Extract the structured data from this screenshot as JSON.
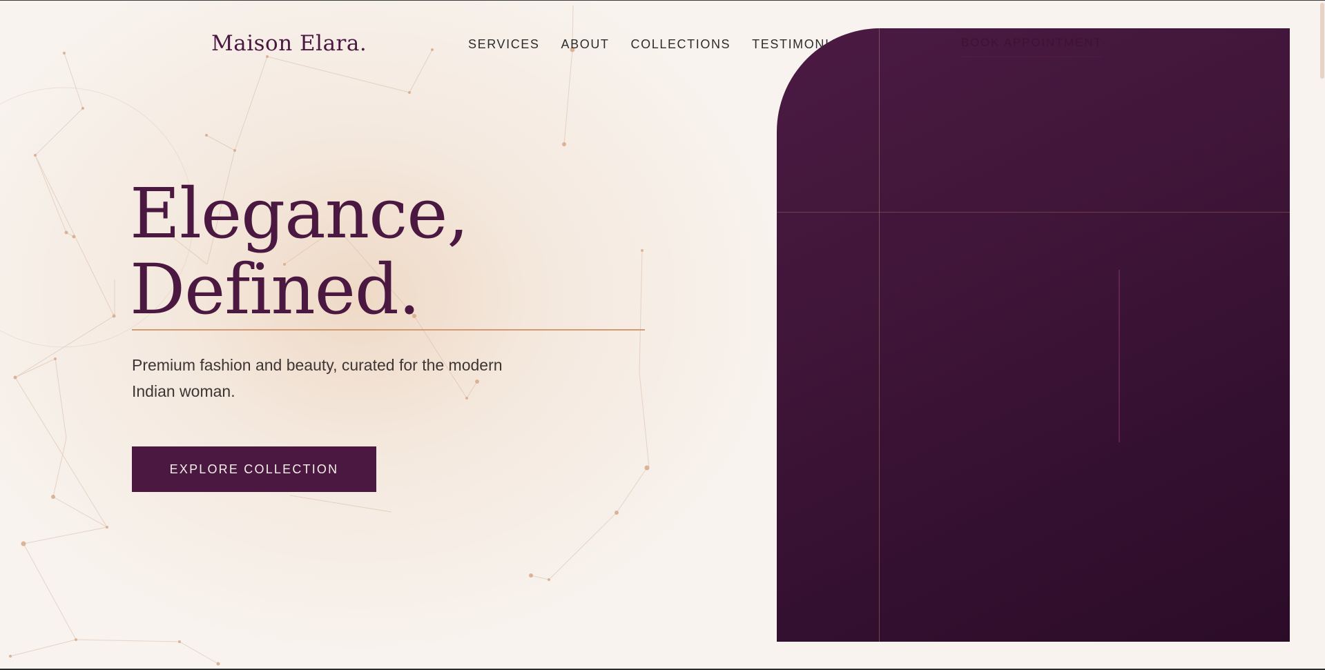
{
  "brand": {
    "name": "Maison Elara."
  },
  "nav": {
    "items": [
      {
        "label": "SERVICES"
      },
      {
        "label": "ABOUT"
      },
      {
        "label": "COLLECTIONS"
      },
      {
        "label": "TESTIMONIALS"
      }
    ],
    "cta_label": "BOOK APPOINTMENT"
  },
  "hero": {
    "title_line1": "Elegance,",
    "title_line2": "Defined.",
    "subtitle": "Premium fashion and beauty, curated for the modern Indian woman.",
    "button_label": "EXPLORE COLLECTION"
  },
  "colors": {
    "brand_plum": "#4a1840",
    "accent_copper": "#d39a72",
    "background_cream": "#f8f3ee",
    "panel_dark": "#2b0c27"
  }
}
